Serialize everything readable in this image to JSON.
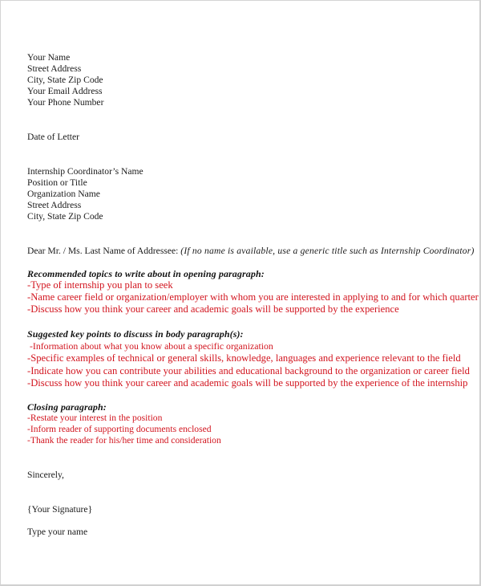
{
  "sender": {
    "name": "Your Name",
    "street": "Street Address",
    "city_state_zip": "City, State  Zip Code",
    "email": "Your Email Address",
    "phone": "Your Phone Number"
  },
  "date": "Date of Letter",
  "recipient": {
    "name": "Internship Coordinator’s Name",
    "position": "Position or Title",
    "organization": "Organization Name",
    "street": "Street Address",
    "city_state_zip": "City, State Zip Code"
  },
  "salutation": {
    "text": "Dear Mr. / Ms. Last Name of Addressee:",
    "note": "(If no name is available, use a generic title such as Internship Coordinator)"
  },
  "sections": [
    {
      "heading": "Recommended topics to write about in opening paragraph:",
      "items": [
        "-Type of internship you plan to seek",
        "-Name career field or organization/employer with whom you are interested in applying to and for which quarter",
        "-Discuss how you think your career and academic goals will be supported by the experience"
      ]
    },
    {
      "heading": "Suggested key points to discuss in body paragraph(s):",
      "items": [
        "-Information about what you know about a specific organization",
        "-Specific examples of technical or general skills, knowledge, languages and experience relevant to the field",
        "-Indicate how you can contribute your abilities and educational background to the organization or career field",
        "-Discuss how you think your career and academic goals will be supported by the experience of the internship"
      ]
    },
    {
      "heading": "Closing paragraph:",
      "items": [
        "-Restate your interest in the position",
        "-Inform reader of supporting documents enclosed",
        "-Thank the reader for his/her time and consideration"
      ]
    }
  ],
  "closing": {
    "valediction": "Sincerely,",
    "signature": "{Your Signature}",
    "typed_name": "Type your name"
  },
  "colors": {
    "instruction_text": "#d2141e",
    "body_text": "#1a1a1a",
    "page_border": "#d4d4d4"
  }
}
